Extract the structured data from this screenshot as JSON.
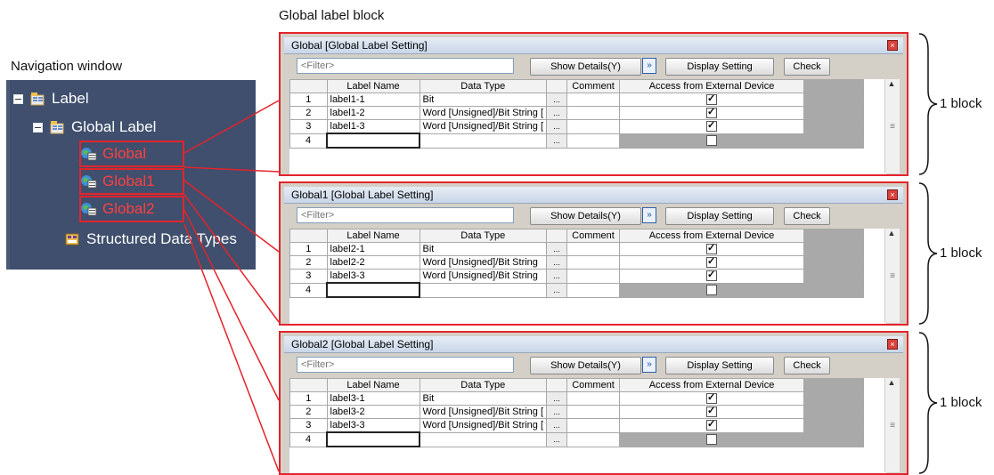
{
  "captions": {
    "global_block": "Global label block",
    "navigation": "Navigation window"
  },
  "tree": {
    "label": "Label",
    "global_label": "Global Label",
    "items": [
      "Global",
      "Global1",
      "Global2"
    ],
    "structured": "Structured Data Types"
  },
  "toolbar": {
    "filter_placeholder": "<Filter>",
    "show_details": "Show Details(Y)",
    "arrow": "»",
    "display_setting": "Display Setting",
    "check": "Check"
  },
  "columns": [
    "Label Name",
    "Data Type",
    "Comment",
    "Access from External Device"
  ],
  "ellipsis": "...",
  "block_label": "1 block",
  "colors": {
    "highlight": "#e3242b",
    "nav_bg": "#3f4f6d",
    "nav_red_text": "#ff4040"
  },
  "blocks": [
    {
      "title": "Global [Global Label Setting]",
      "rows": [
        {
          "num": "1",
          "name": "label1-1",
          "type": "Bit",
          "checked": true
        },
        {
          "num": "2",
          "name": "label1-2",
          "type": "Word [Unsigned]/Bit String [",
          "checked": true
        },
        {
          "num": "3",
          "name": "label1-3",
          "type": "Word [Unsigned]/Bit String [",
          "checked": true
        },
        {
          "num": "4",
          "name": "",
          "type": "",
          "checked": false
        }
      ]
    },
    {
      "title": "Global1 [Global Label Setting]",
      "rows": [
        {
          "num": "1",
          "name": "label2-1",
          "type": "Bit",
          "checked": true
        },
        {
          "num": "2",
          "name": "label2-2",
          "type": "Word [Unsigned]/Bit String",
          "checked": true
        },
        {
          "num": "3",
          "name": "label3-3",
          "type": "Word [Unsigned]/Bit String",
          "checked": true
        },
        {
          "num": "4",
          "name": "",
          "type": "",
          "checked": false
        }
      ]
    },
    {
      "title": "Global2 [Global Label Setting]",
      "rows": [
        {
          "num": "1",
          "name": "label3-1",
          "type": "Bit",
          "checked": true
        },
        {
          "num": "2",
          "name": "label3-2",
          "type": "Word [Unsigned]/Bit String [",
          "checked": true
        },
        {
          "num": "3",
          "name": "label3-3",
          "type": "Word [Unsigned]/Bit String [",
          "checked": true
        },
        {
          "num": "4",
          "name": "",
          "type": "",
          "checked": false
        }
      ]
    }
  ]
}
